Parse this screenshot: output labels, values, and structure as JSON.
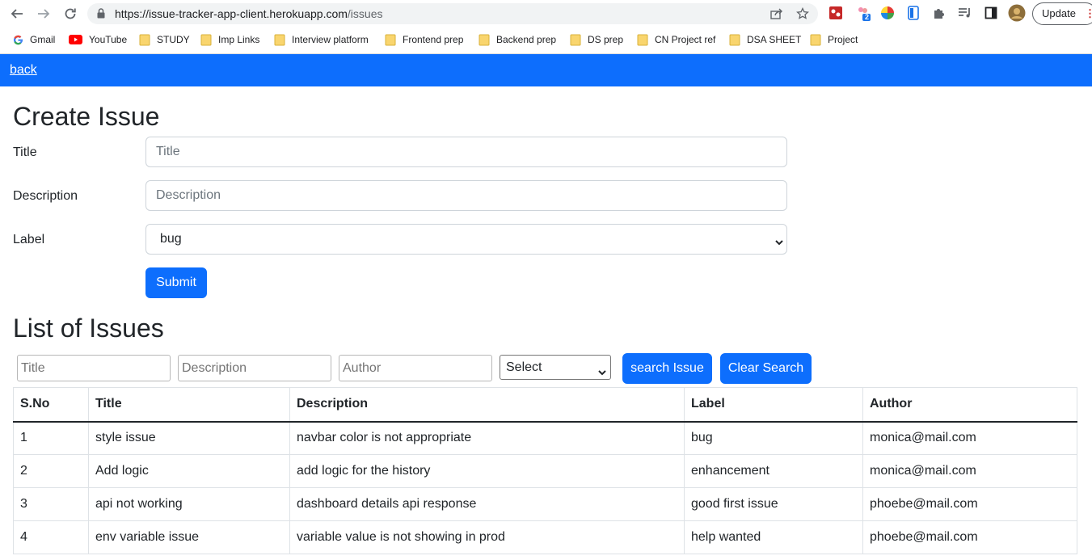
{
  "browser": {
    "url_host": "https://issue-tracker-app-client.herokuapp.com",
    "url_path": "/issues",
    "update_label": "Update",
    "extension_badge": "2",
    "bookmarks": [
      {
        "label": "Gmail",
        "icon": "google-icon"
      },
      {
        "label": "YouTube",
        "icon": "youtube-icon"
      },
      {
        "label": "STUDY",
        "icon": "folder-icon"
      },
      {
        "label": "Imp Links",
        "icon": "folder-icon"
      },
      {
        "label": "Interview platform",
        "icon": "folder-icon"
      },
      {
        "label": "Frontend prep",
        "icon": "folder-icon"
      },
      {
        "label": "Backend prep",
        "icon": "folder-icon"
      },
      {
        "label": "DS prep",
        "icon": "folder-icon"
      },
      {
        "label": "CN Project ref",
        "icon": "folder-icon"
      },
      {
        "label": "DSA SHEET",
        "icon": "folder-icon"
      },
      {
        "label": "Project",
        "icon": "folder-icon"
      }
    ]
  },
  "colors": {
    "primary": "#0d6efd",
    "folder": "#f9d56e",
    "youtube": "#ff0000"
  },
  "app": {
    "back_label": "back",
    "create": {
      "heading": "Create Issue",
      "title_label": "Title",
      "title_placeholder": "Title",
      "description_label": "Description",
      "description_placeholder": "Description",
      "label_label": "Label",
      "label_value": "bug",
      "submit_label": "Submit"
    },
    "list": {
      "heading": "List of Issues",
      "search": {
        "title_placeholder": "Title",
        "description_placeholder": "Description",
        "author_placeholder": "Author",
        "select_value": "Select",
        "search_label": "search Issue",
        "clear_label": "Clear Search"
      },
      "columns": [
        "S.No",
        "Title",
        "Description",
        "Label",
        "Author"
      ],
      "rows": [
        [
          "1",
          "style issue",
          "navbar color is not appropriate",
          "bug",
          "monica@mail.com"
        ],
        [
          "2",
          "Add logic",
          "add logic for the history",
          "enhancement",
          "monica@mail.com"
        ],
        [
          "3",
          "api not working",
          "dashboard details api response",
          "good first issue",
          "phoebe@mail.com"
        ],
        [
          "4",
          "env variable issue",
          "variable value is not showing in prod",
          "help wanted",
          "phoebe@mail.com"
        ]
      ]
    }
  }
}
